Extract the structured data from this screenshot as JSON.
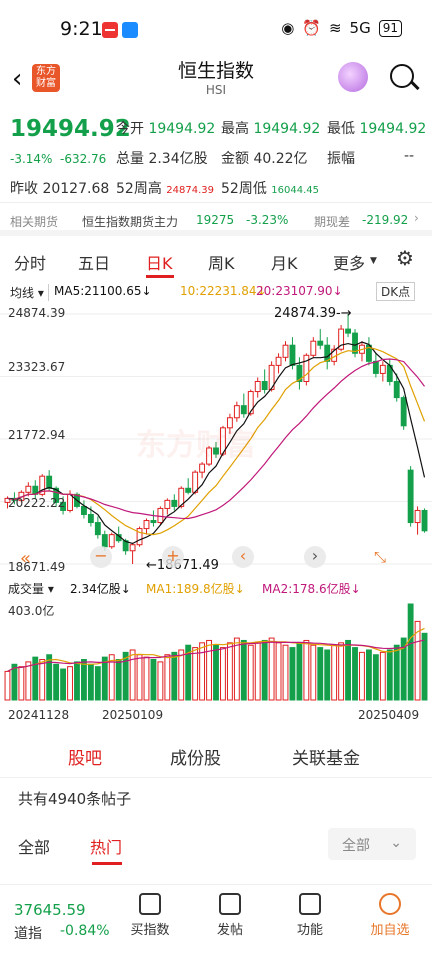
{
  "status": {
    "time": "9:21",
    "signal": "5G",
    "battery": "91"
  },
  "header": {
    "logo": "东方\n财富",
    "title": "恒生指数",
    "subtitle": "HSI"
  },
  "quote": {
    "price": "19494.92",
    "change_pct": "-3.14%",
    "change": "-632.76",
    "open_label": "今开",
    "open": "19494.92",
    "high_label": "最高",
    "high": "19494.92",
    "low_label": "最低",
    "low": "19494.92",
    "vol_label": "总量",
    "vol": "2.34亿股",
    "amt_label": "金额",
    "amt": "40.22亿",
    "amp_label": "振幅",
    "amp": "--",
    "prev_label": "昨收",
    "prev": "20127.68",
    "h52_label": "52周高",
    "h52": "24874.39",
    "l52_label": "52周低",
    "l52": "16044.45"
  },
  "futures": {
    "label": "相关期货",
    "name": "恒生指数期货主力",
    "price": "19275",
    "pct": "-3.23%",
    "basis_label": "期现差",
    "basis": "-219.92"
  },
  "tabs": [
    "分时",
    "五日",
    "日K",
    "周K",
    "月K",
    "更多"
  ],
  "active_tab": "日K",
  "ma": {
    "label": "均线",
    "ma5": "MA5:21100.65↓",
    "ma10": "10:22231.84↓",
    "ma20": "20:23107.90↓",
    "dk": "DK点"
  },
  "axis": {
    "y1": "24874.39",
    "y2": "23323.67",
    "y3": "21772.94",
    "y4": "20222.22",
    "y5": "18671.49"
  },
  "annotations": {
    "high": "24874.39",
    "low": "18671.49"
  },
  "watermark": "东方财富",
  "volume": {
    "label": "成交量",
    "vol": "2.34亿股↓",
    "ma1": "MA1:189.8亿股↓",
    "ma2": "MA2:178.6亿股↓",
    "max": "403.0亿"
  },
  "dates": {
    "d1": "20241128",
    "d2": "20250109",
    "d3": "20250409"
  },
  "subtabs": [
    "股吧",
    "成份股",
    "关联基金"
  ],
  "posts": "共有4940条帖子",
  "feed": {
    "all": "全部",
    "hot": "热门",
    "select": "全部"
  },
  "nav": {
    "idx_value": "37645.59",
    "idx_name": "道指",
    "idx_pct": "-0.84%",
    "items": [
      "买指数",
      "发帖",
      "功能",
      "加自选"
    ]
  },
  "colors": {
    "up": "#e02020",
    "down": "#14a04b",
    "ma5": "#111111",
    "ma10": "#e0a000",
    "ma20": "#c0187a"
  },
  "chart_data": {
    "type": "candlestick",
    "ylim": [
      18671.49,
      24874.39
    ],
    "candles": [
      [
        20200,
        20350,
        20050,
        20300
      ],
      [
        20300,
        20450,
        20150,
        20250
      ],
      [
        20250,
        20500,
        20200,
        20450
      ],
      [
        20450,
        20700,
        20350,
        20600
      ],
      [
        20600,
        20750,
        20300,
        20400
      ],
      [
        20400,
        20900,
        20350,
        20850
      ],
      [
        20850,
        21000,
        20500,
        20550
      ],
      [
        20550,
        20600,
        20100,
        20200
      ],
      [
        20200,
        20350,
        19900,
        20000
      ],
      [
        20000,
        20500,
        19950,
        20400
      ],
      [
        20400,
        20450,
        20050,
        20100
      ],
      [
        20100,
        20250,
        19800,
        19900
      ],
      [
        19900,
        20100,
        19600,
        19700
      ],
      [
        19700,
        19850,
        19300,
        19400
      ],
      [
        19400,
        19500,
        19000,
        19100
      ],
      [
        19100,
        19450,
        19050,
        19400
      ],
      [
        19400,
        19600,
        19200,
        19250
      ],
      [
        19250,
        19300,
        18900,
        19000
      ],
      [
        19000,
        19200,
        18671,
        19150
      ],
      [
        19150,
        19600,
        19100,
        19550
      ],
      [
        19550,
        19800,
        19400,
        19750
      ],
      [
        19750,
        20000,
        19600,
        19700
      ],
      [
        19700,
        20100,
        19650,
        20050
      ],
      [
        20050,
        20300,
        19900,
        20250
      ],
      [
        20250,
        20400,
        20000,
        20100
      ],
      [
        20100,
        20600,
        20050,
        20550
      ],
      [
        20550,
        20800,
        20400,
        20450
      ],
      [
        20450,
        21000,
        20400,
        20950
      ],
      [
        20950,
        21200,
        20800,
        21150
      ],
      [
        21150,
        21600,
        21100,
        21550
      ],
      [
        21550,
        21700,
        21300,
        21400
      ],
      [
        21400,
        22100,
        21350,
        22050
      ],
      [
        22050,
        22400,
        21900,
        22300
      ],
      [
        22300,
        22700,
        22200,
        22600
      ],
      [
        22600,
        22900,
        22300,
        22400
      ],
      [
        22400,
        23000,
        22350,
        22950
      ],
      [
        22950,
        23300,
        22800,
        23200
      ],
      [
        23200,
        23500,
        22900,
        23000
      ],
      [
        23000,
        23700,
        22950,
        23600
      ],
      [
        23600,
        23900,
        23400,
        23800
      ],
      [
        23800,
        24200,
        23700,
        24100
      ],
      [
        24100,
        24300,
        23500,
        23600
      ],
      [
        23600,
        23800,
        23000,
        23200
      ],
      [
        23200,
        23900,
        23100,
        23850
      ],
      [
        23850,
        24300,
        23800,
        24200
      ],
      [
        24200,
        24500,
        24000,
        24100
      ],
      [
        24100,
        24300,
        23500,
        23700
      ],
      [
        23700,
        24100,
        23600,
        24000
      ],
      [
        24000,
        24600,
        23950,
        24500
      ],
      [
        24500,
        24874,
        24300,
        24400
      ],
      [
        24400,
        24500,
        23800,
        23900
      ],
      [
        23900,
        24200,
        23700,
        24100
      ],
      [
        24100,
        24300,
        23600,
        23700
      ],
      [
        23700,
        23900,
        23300,
        23400
      ],
      [
        23400,
        23700,
        23200,
        23600
      ],
      [
        23600,
        23750,
        23100,
        23200
      ],
      [
        23200,
        23400,
        22700,
        22800
      ],
      [
        22800,
        22850,
        22000,
        22100
      ],
      [
        21000,
        21100,
        19600,
        19700
      ],
      [
        19700,
        20100,
        19400,
        20000
      ],
      [
        20000,
        20050,
        19450,
        19495
      ]
    ],
    "volumes": [
      120,
      150,
      140,
      160,
      180,
      170,
      190,
      150,
      130,
      140,
      160,
      170,
      150,
      140,
      180,
      190,
      170,
      200,
      210,
      190,
      180,
      170,
      160,
      190,
      200,
      210,
      230,
      220,
      240,
      250,
      230,
      220,
      240,
      260,
      250,
      230,
      240,
      250,
      260,
      240,
      230,
      220,
      240,
      250,
      230,
      220,
      210,
      230,
      240,
      250,
      220,
      200,
      210,
      190,
      200,
      210,
      230,
      260,
      403,
      330,
      280
    ],
    "ma5": [],
    "ma10": [],
    "ma20": []
  }
}
